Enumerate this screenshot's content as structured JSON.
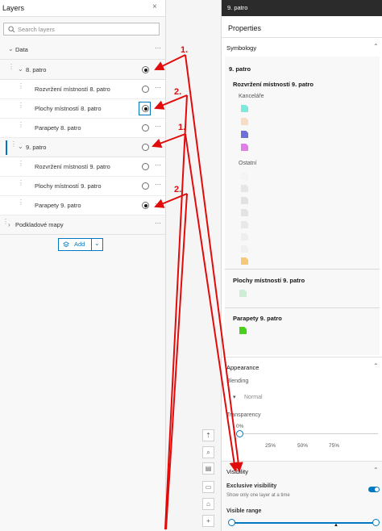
{
  "layers_panel": {
    "title": "Layers",
    "close_glyph": "×",
    "search_placeholder": "Search layers",
    "group_data": "Data",
    "rows": [
      {
        "label": "8. patro",
        "selected": true
      },
      {
        "label": "Rozvržení místností 8. patro",
        "selected": false
      },
      {
        "label": "Plochy místností 8. patro",
        "selected": true
      },
      {
        "label": "Parapety 8. patro",
        "selected": false
      },
      {
        "label": "9. patro",
        "selected": false
      },
      {
        "label": "Rozvržení místností 9. patro",
        "selected": false
      },
      {
        "label": "Plochy místností 9. patro",
        "selected": false
      },
      {
        "label": "Parapety 9. patro",
        "selected": true
      }
    ],
    "basemap_group": "Podkladové mapy",
    "add_label": "Add",
    "more_glyph": "···"
  },
  "annotations": {
    "one": "1.",
    "two": "2.",
    "color": "#e10b0b"
  },
  "properties_panel": {
    "header_title": "9. patro",
    "title": "Properties",
    "symbology_title": "Symbology",
    "layer_title": "9. patro",
    "rozvrzeni_title": "Rozvržení místností 9. patro",
    "kancelare_label": "Kanceláře",
    "kancelare_colors": [
      "#7ee8dc",
      "#f7dcc6",
      "#6f6fd8",
      "#e07ee7"
    ],
    "ostatni_label": "Ostatní",
    "ostatni_colors": [
      "#f4f4f4",
      "#e6e6e6",
      "#e2e2e2",
      "#e3e3e3",
      "#e8e8e8",
      "#eeeeee",
      "#f0f0f0",
      "#f6c87a"
    ],
    "plochy_title": "Plochy místností 9. patro",
    "plochy_color": "#cdeed5",
    "parapety_title": "Parapety 9. patro",
    "parapety_color": "#48d11a",
    "appearance_title": "Appearance",
    "blending_label": "Blending",
    "blending_value": "Normal",
    "transparency_label": "Transparency",
    "transparency_ticks": [
      "0%",
      "25%",
      "50%",
      "75%"
    ],
    "transparency_value": 0,
    "visibility_title": "Visibility",
    "exclusive_label": "Exclusive visibility",
    "exclusive_desc": "Show only one layer at a time",
    "exclusive_on": true,
    "visible_range_label": "Visible range"
  },
  "accent_color": "#0079c1"
}
